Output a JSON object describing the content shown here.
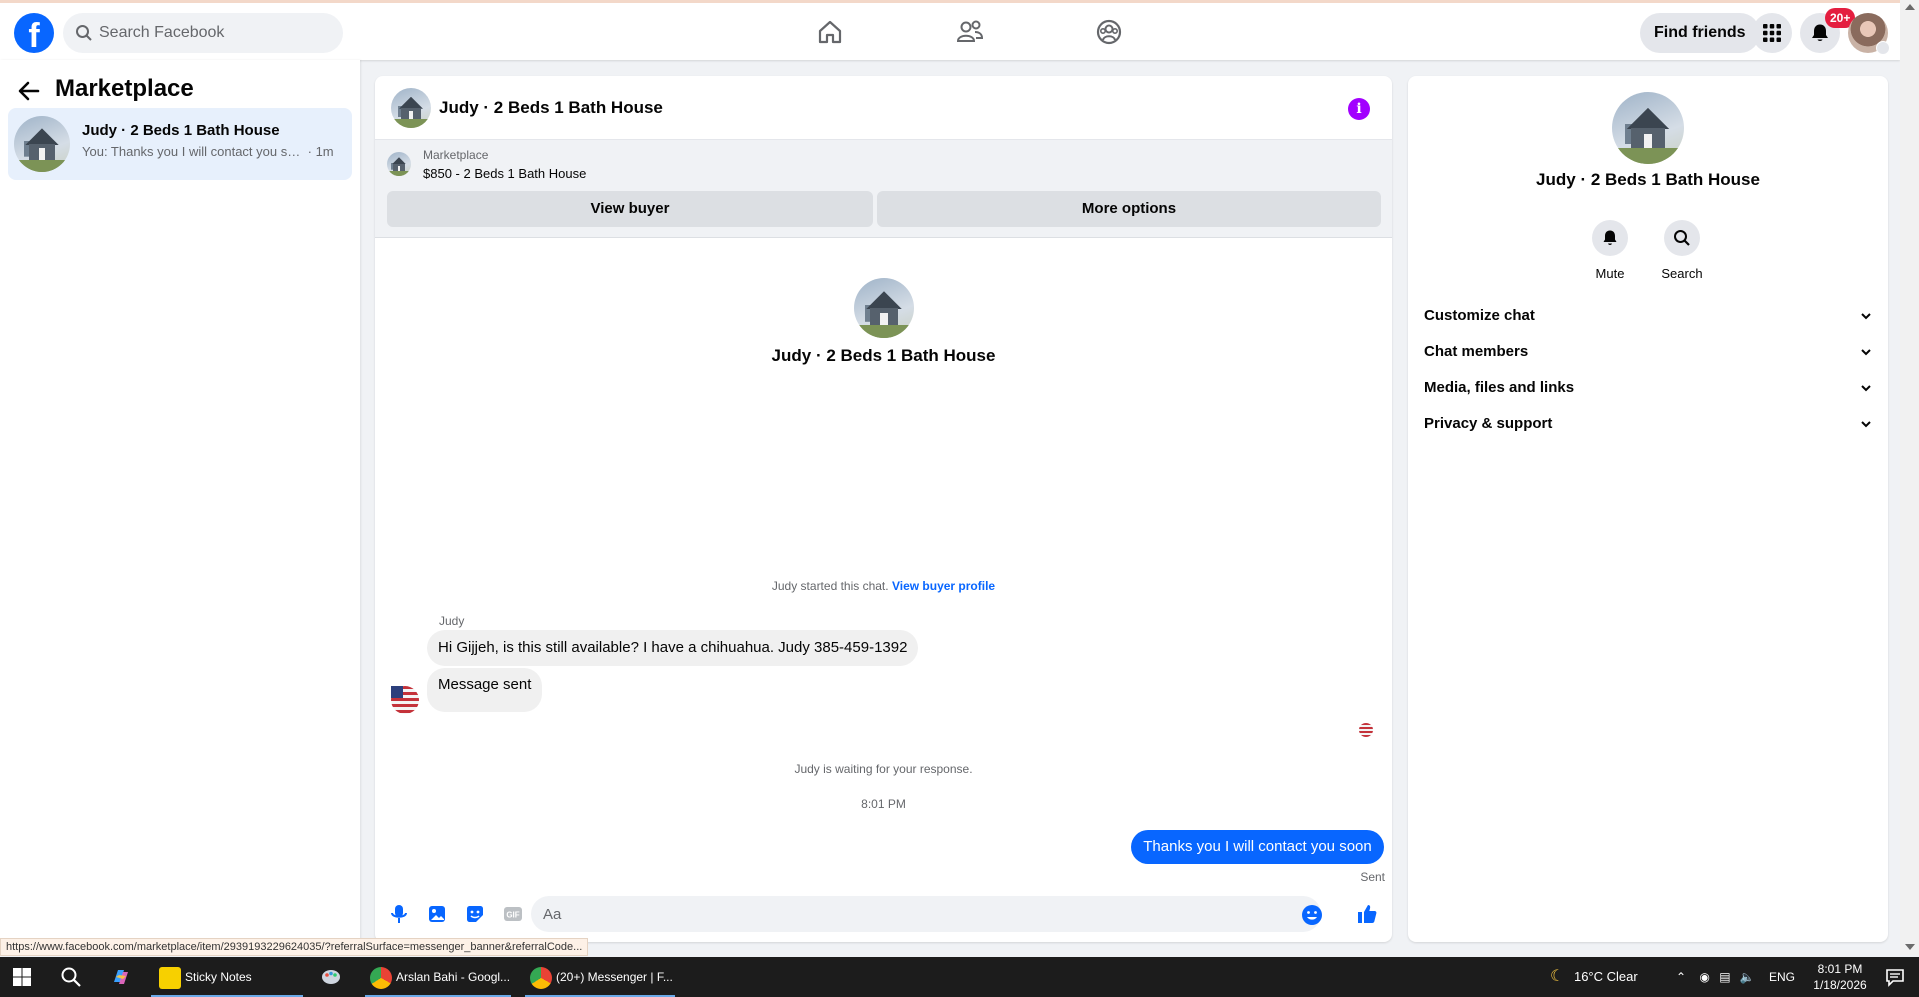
{
  "colors": {
    "brand": "#0866ff",
    "accent_info": "#a200ff",
    "badge_red": "#e41e3f",
    "outgoing_bubble": "#0866ff"
  },
  "topbar": {
    "logo_icon": "facebook-logo",
    "search_placeholder": "Search Facebook",
    "nav_icons": [
      "home-icon",
      "friends-icon",
      "groups-icon"
    ],
    "find_friends_label": "Find friends",
    "menu_icon": "grid-menu-icon",
    "notifications_icon": "bell-icon",
    "notifications_badge": "20+"
  },
  "sidebar": {
    "title": "Marketplace",
    "conversations": [
      {
        "name": "Judy · 2 Beds 1 Bath House",
        "preview": "You: Thanks you I will contact you so...",
        "time": "· 1m"
      }
    ]
  },
  "chat": {
    "header_title": "Judy · 2 Beds 1 Bath House",
    "marketplace_label": "Marketplace",
    "listing": "$850 - 2 Beds 1 Bath House",
    "view_buyer_label": "View buyer",
    "more_options_label": "More options",
    "intro_name": "Judy · 2 Beds 1 Bath House",
    "started_text": "Judy started this chat.",
    "view_buyer_profile_label": "View buyer profile",
    "sender_name": "Judy",
    "messages_in": [
      "Hi Gijjeh, is this still available?  I have a chihuahua.  Judy 385-459-1392",
      "Message sent"
    ],
    "waiting_text": "Judy is waiting for your response.",
    "timestamp": "8:01 PM",
    "message_out": "Thanks you I will contact you soon",
    "sent_status": "Sent",
    "composer_placeholder": "Aa",
    "composer_icons": [
      "microphone-icon",
      "photo-icon",
      "sticker-icon",
      "gif-icon",
      "emoji-icon",
      "like-icon"
    ]
  },
  "details": {
    "name": "Judy · 2 Beds 1 Bath House",
    "mute_label": "Mute",
    "search_label": "Search",
    "sections": [
      "Customize chat",
      "Chat members",
      "Media, files and links",
      "Privacy & support"
    ]
  },
  "status_url": "https://www.facebook.com/marketplace/item/2939193229624035/?referralSurface=messenger_banner&referralCode...",
  "taskbar": {
    "apps": [
      "Sticky Notes",
      "Arslan Bahi - Googl...",
      "(20+) Messenger | F..."
    ],
    "weather": "16°C  Clear",
    "language": "ENG",
    "time": "8:01 PM",
    "date": "1/18/2026"
  }
}
